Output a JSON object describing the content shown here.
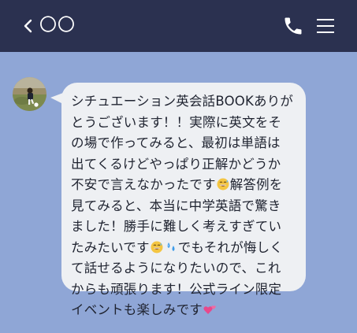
{
  "header": {
    "title": "〇〇"
  },
  "message": {
    "lines": [
      "シチュエーション英会話BOOKありが",
      "とうございます！！実際に英文をそ",
      "の場で作ってみると、最初は単語は",
      "出てくるけどやっぱり正解かどうか",
      "不安で言えなかったです",
      "解答例を",
      "見てみると、本当に中学英語で驚き",
      "ました！勝手に難しく考えすぎてい",
      "たみたいです",
      "でもそれが悔しく",
      "て話せるようになりたいので、これ",
      "からも頑張ります！公式ライン限定",
      "イベントも楽しみです"
    ]
  },
  "icons": {
    "back": "chevron-left-icon",
    "call": "phone-icon",
    "menu": "hamburger-menu-icon",
    "emoji_grin": "grinning-sweat-emoji",
    "emoji_sweat": "sweat-droplets-emoji",
    "emoji_heart": "two-hearts-emoji"
  },
  "colors": {
    "header_bg": "#2b3150",
    "chat_bg": "#8fa6d6",
    "bubble_bg": "#eef0f3",
    "text": "#1f2330"
  }
}
